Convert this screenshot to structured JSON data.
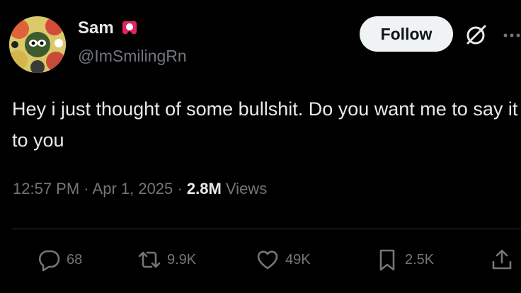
{
  "author": {
    "name": "Sam",
    "handle": "@ImSmilingRn"
  },
  "follow_label": "Follow",
  "post": {
    "text": "Hey i just thought of some bullshit. Do you want me to say it to you",
    "time": "12:57 PM",
    "date": "Apr 1, 2025",
    "views_count": "2.8M",
    "views_label": "Views"
  },
  "actions": {
    "replies": "68",
    "reposts": "9.9K",
    "likes": "49K",
    "bookmarks": "2.5K"
  },
  "icons": [
    "avatar",
    "flag-icon",
    "grok-icon",
    "more-icon",
    "reply-icon",
    "repost-icon",
    "like-icon",
    "bookmark-icon",
    "share-icon"
  ],
  "colors": {
    "background": "#000000",
    "text": "#e7e9ea",
    "muted": "#71767b",
    "follow_bg": "#eff3f4",
    "flag": "#e0245e"
  }
}
